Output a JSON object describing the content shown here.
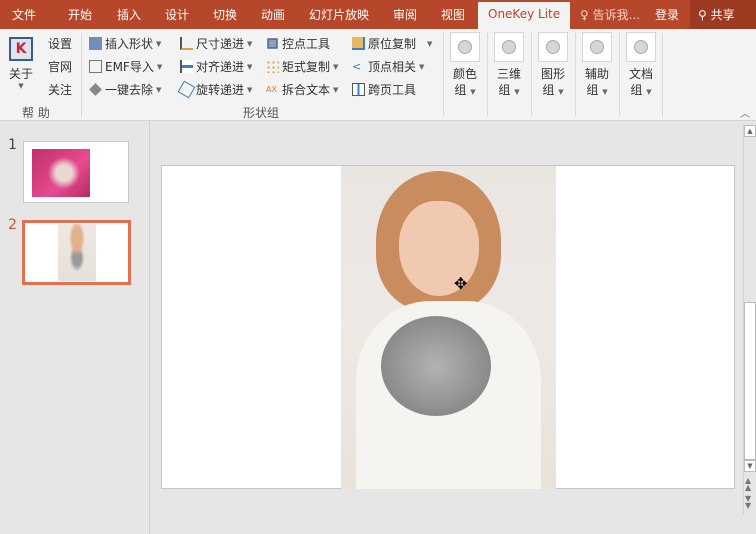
{
  "tabs": [
    "文件",
    "开始",
    "插入",
    "设计",
    "切换",
    "动画",
    "幻灯片放映",
    "审阅",
    "视图",
    "OneKey Lite"
  ],
  "tell_me": "告诉我...",
  "login": "登录",
  "share": "共享",
  "help_group": {
    "about": "关于",
    "items": [
      "设置",
      "官网",
      "关注"
    ],
    "label": "帮 助"
  },
  "shape_group": {
    "label": "形状组",
    "rows": [
      [
        "插入形状",
        "尺寸递进",
        "控点工具",
        "原位复制"
      ],
      [
        "EMF导入",
        "对齐递进",
        "矩式复制",
        "顶点相关"
      ],
      [
        "一键去除",
        "旋转递进",
        "拆合文本",
        "跨页工具"
      ]
    ]
  },
  "big_buttons": [
    {
      "l1": "颜色",
      "l2": "组"
    },
    {
      "l1": "三维",
      "l2": "组"
    },
    {
      "l1": "图形",
      "l2": "组"
    },
    {
      "l1": "辅助",
      "l2": "组"
    },
    {
      "l1": "文档",
      "l2": "组"
    }
  ],
  "slides": [
    {
      "num": "1"
    },
    {
      "num": "2"
    }
  ],
  "colors": {
    "accent": "#b7472a",
    "selected": "#e5704f"
  }
}
